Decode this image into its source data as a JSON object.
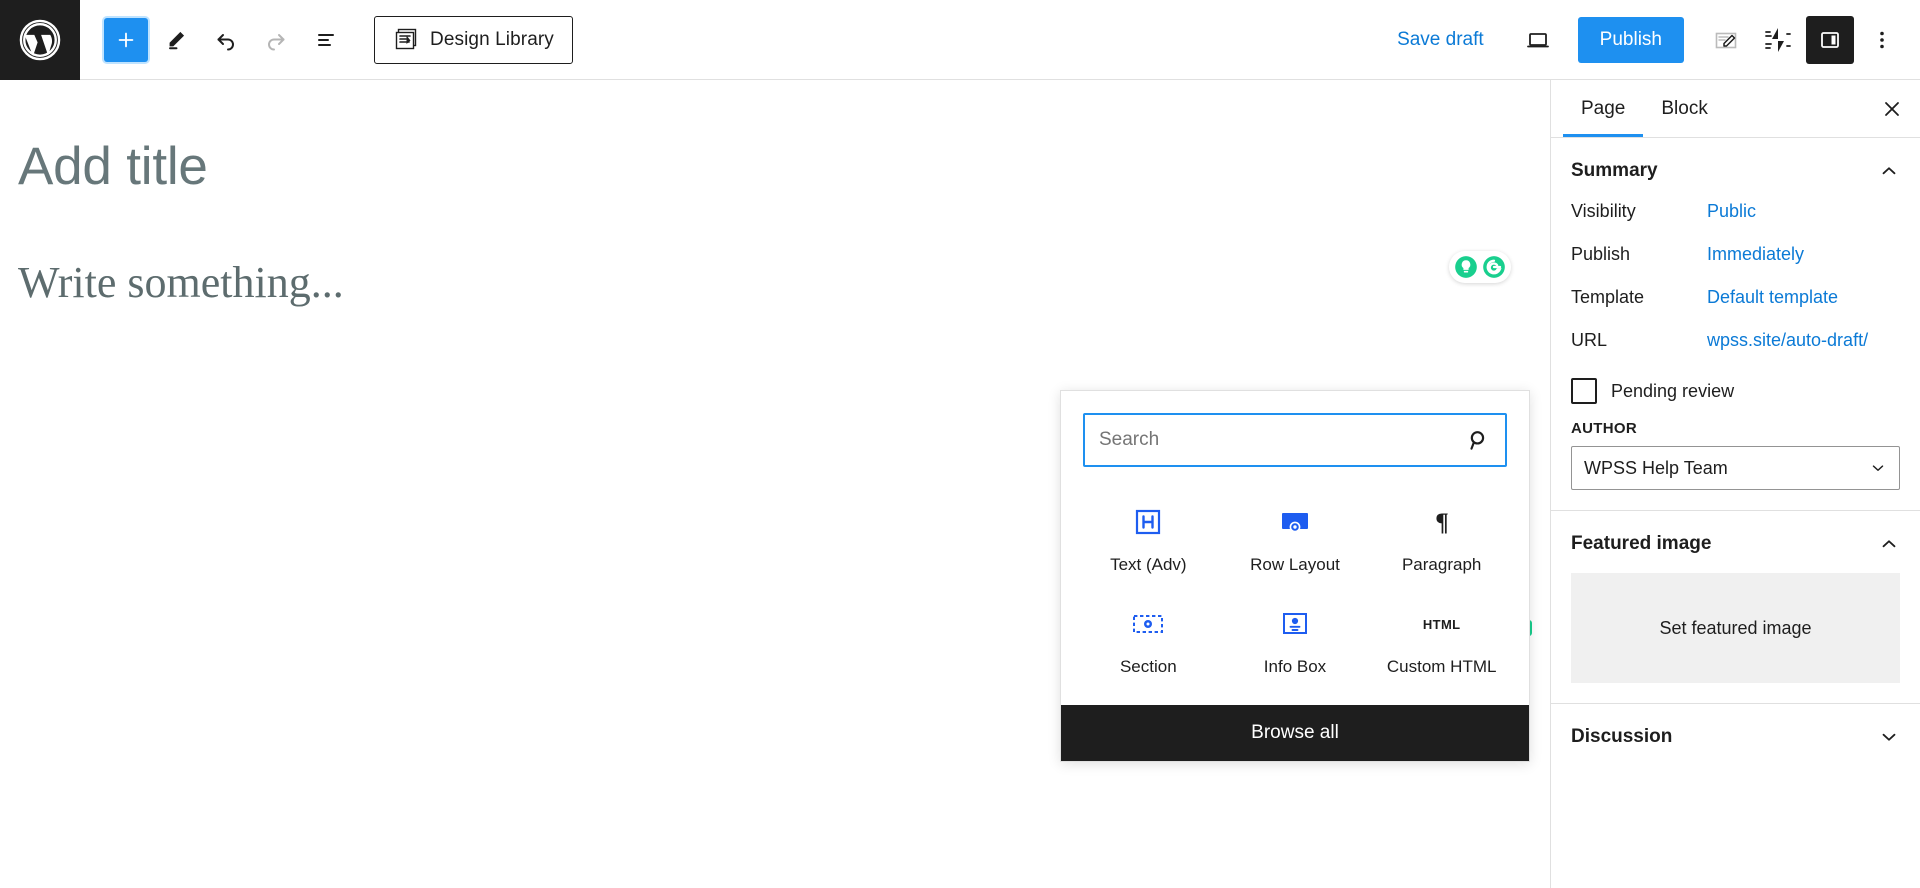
{
  "toolbar": {
    "logo_icon": "wordpress-logo-icon",
    "add_block_label": "+",
    "tools": [
      {
        "name": "add-block-button",
        "icon": "plus-icon"
      },
      {
        "name": "edit-tool-button",
        "icon": "pencil-icon"
      },
      {
        "name": "undo-button",
        "icon": "undo-icon"
      },
      {
        "name": "redo-button",
        "icon": "redo-icon"
      },
      {
        "name": "list-view-button",
        "icon": "list-view-icon"
      }
    ],
    "design_library_label": "Design Library",
    "design_library_icon": "design-library-icon",
    "save_draft_label": "Save draft",
    "preview_icon": "desktop-preview-icon",
    "publish_label": "Publish",
    "settings_icon": "edit-box-icon",
    "jetpack_icon": "jetpack-icon",
    "sidebar_toggle_icon": "sidebar-panel-icon",
    "options_icon": "more-vertical-icon",
    "accent_blue": "#1e90f0",
    "link_blue": "#0b7ad6"
  },
  "editor": {
    "title_placeholder": "Add title",
    "body_placeholder": "Write something...",
    "assist_icons": [
      "lightbulb-icon",
      "grammarly-g-icon"
    ],
    "assist_color": "#19cf8e",
    "add_block_label": "+"
  },
  "inserter": {
    "search_value": "",
    "search_placeholder": "Search",
    "search_icon": "search-icon",
    "blocks": [
      {
        "label": "Text (Adv)",
        "icon": "heading-h-icon",
        "color": "#1e5df0"
      },
      {
        "label": "Row Layout",
        "icon": "row-layout-icon",
        "color": "#1e5df0"
      },
      {
        "label": "Paragraph",
        "icon": "pilcrow-icon",
        "color": "#1e1e1e"
      },
      {
        "label": "Section",
        "icon": "section-icon",
        "color": "#1e5df0"
      },
      {
        "label": "Info Box",
        "icon": "info-box-icon",
        "color": "#1e5df0"
      },
      {
        "label": "Custom HTML",
        "icon": "custom-html-icon",
        "color": "#1e1e1e",
        "glyph": "HTML"
      }
    ],
    "browse_all_label": "Browse all"
  },
  "sidebar": {
    "tabs": [
      {
        "label": "Page",
        "active": true
      },
      {
        "label": "Block",
        "active": false
      }
    ],
    "close_icon": "close-icon",
    "summary": {
      "title": "Summary",
      "collapse_icon": "chevron-up-icon",
      "rows": [
        {
          "key": "Visibility",
          "value": "Public"
        },
        {
          "key": "Publish",
          "value": "Immediately"
        },
        {
          "key": "Template",
          "value": "Default template"
        },
        {
          "key": "URL",
          "value": "wpss.site/auto-draft/"
        }
      ],
      "pending_review_label": "Pending review",
      "pending_review_checked": false,
      "author_label": "AUTHOR",
      "author_value": "WPSS Help Team"
    },
    "featured_image": {
      "title": "Featured image",
      "collapse_icon": "chevron-up-icon",
      "set_label": "Set featured image"
    },
    "discussion": {
      "title": "Discussion",
      "collapse_icon": "chevron-down-icon"
    }
  }
}
